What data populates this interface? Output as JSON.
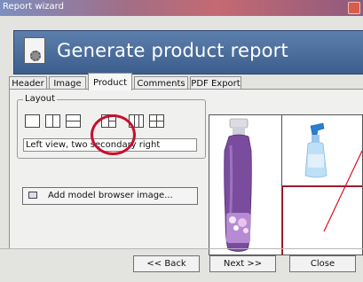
{
  "window": {
    "title": "Report wizard"
  },
  "header": {
    "title": "Generate product report",
    "icon": "report-settings-icon"
  },
  "tabs": [
    {
      "label": "Header",
      "active": false
    },
    {
      "label": "Image",
      "active": false
    },
    {
      "label": "Product",
      "active": true
    },
    {
      "label": "Comments",
      "active": false
    },
    {
      "label": "PDF Export",
      "active": false
    }
  ],
  "layout": {
    "group_label": "Layout",
    "options": [
      "single-view-icon",
      "two-columns-icon",
      "two-rows-icon",
      "left-view-two-secondary-right-icon",
      "three-columns-icon",
      "four-views-icon"
    ],
    "selected_index": 3,
    "description": "Left view, two secondary right"
  },
  "add_button": {
    "label": "Add model browser image...",
    "icon": "image-icon"
  },
  "footer": {
    "back_label": "<< Back",
    "next_label": "Next >>",
    "close_label": "Close"
  },
  "colors": {
    "header_blue": "#4a6b97",
    "highlight_red": "#c8102e"
  }
}
